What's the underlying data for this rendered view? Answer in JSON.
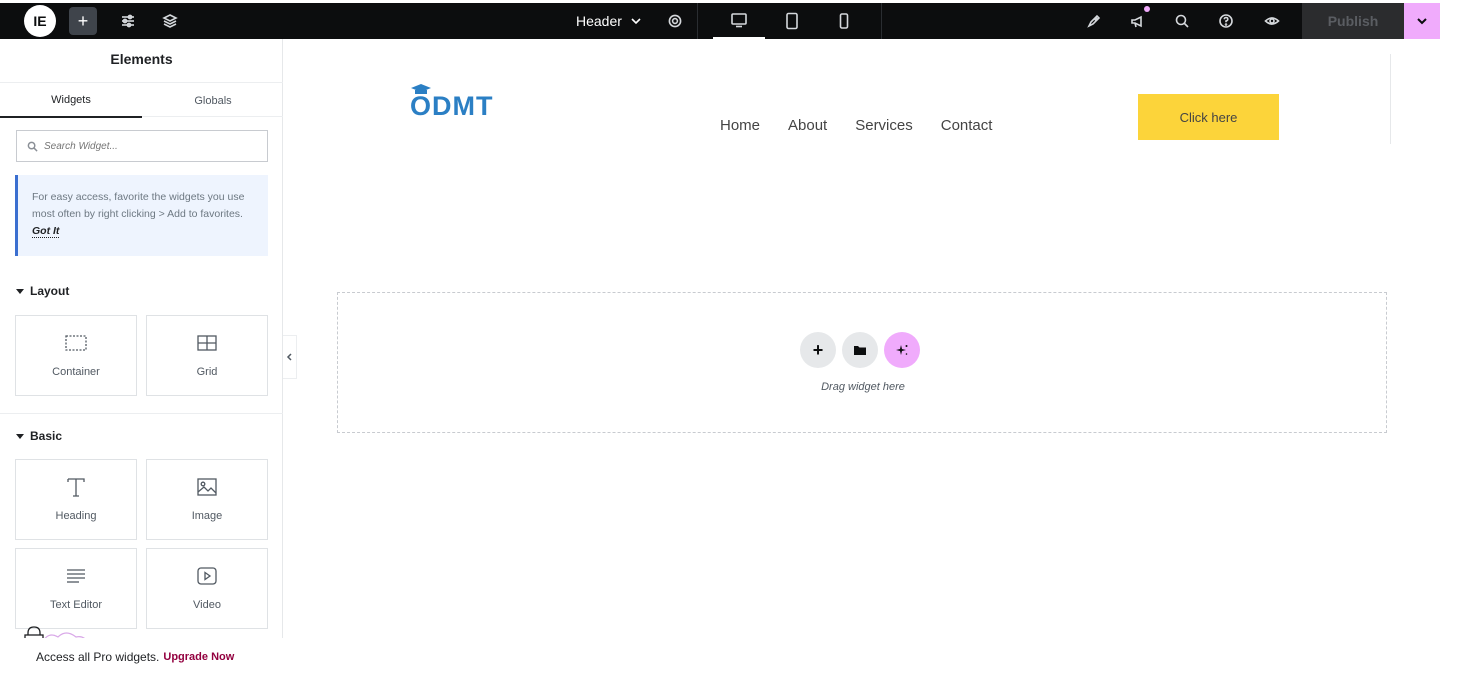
{
  "topbar": {
    "logo": "IE",
    "add_label": "+",
    "document_title": "Header",
    "publish_label": "Publish"
  },
  "sidebar": {
    "title": "Elements",
    "tabs": [
      {
        "label": "Widgets",
        "active": true
      },
      {
        "label": "Globals",
        "active": false
      }
    ],
    "search": {
      "placeholder": "Search Widget..."
    },
    "tip": {
      "text": "For easy access, favorite the widgets you use most often by right clicking > Add to favorites.",
      "action": "Got It"
    },
    "categories": [
      {
        "name": "Layout",
        "widgets": [
          {
            "label": "Container",
            "icon": "container-icon"
          },
          {
            "label": "Grid",
            "icon": "grid-icon"
          }
        ]
      },
      {
        "name": "Basic",
        "widgets": [
          {
            "label": "Heading",
            "icon": "heading-icon"
          },
          {
            "label": "Image",
            "icon": "image-icon"
          },
          {
            "label": "Text Editor",
            "icon": "text-editor-icon"
          },
          {
            "label": "Video",
            "icon": "video-icon"
          }
        ]
      }
    ],
    "upgrade": {
      "text": "Access all Pro widgets.",
      "link": "Upgrade Now"
    }
  },
  "canvas": {
    "logo_text": "ODMT",
    "nav": [
      "Home",
      "About",
      "Services",
      "Contact"
    ],
    "cta_label": "Click here",
    "dropzone_text": "Drag widget here"
  },
  "colors": {
    "topbar_bg": "#0c0d0e",
    "accent_pink": "#f0abfc",
    "cta_yellow": "#fcd43a",
    "logo_blue": "#2b7fc4",
    "upgrade_link": "#93003f"
  }
}
